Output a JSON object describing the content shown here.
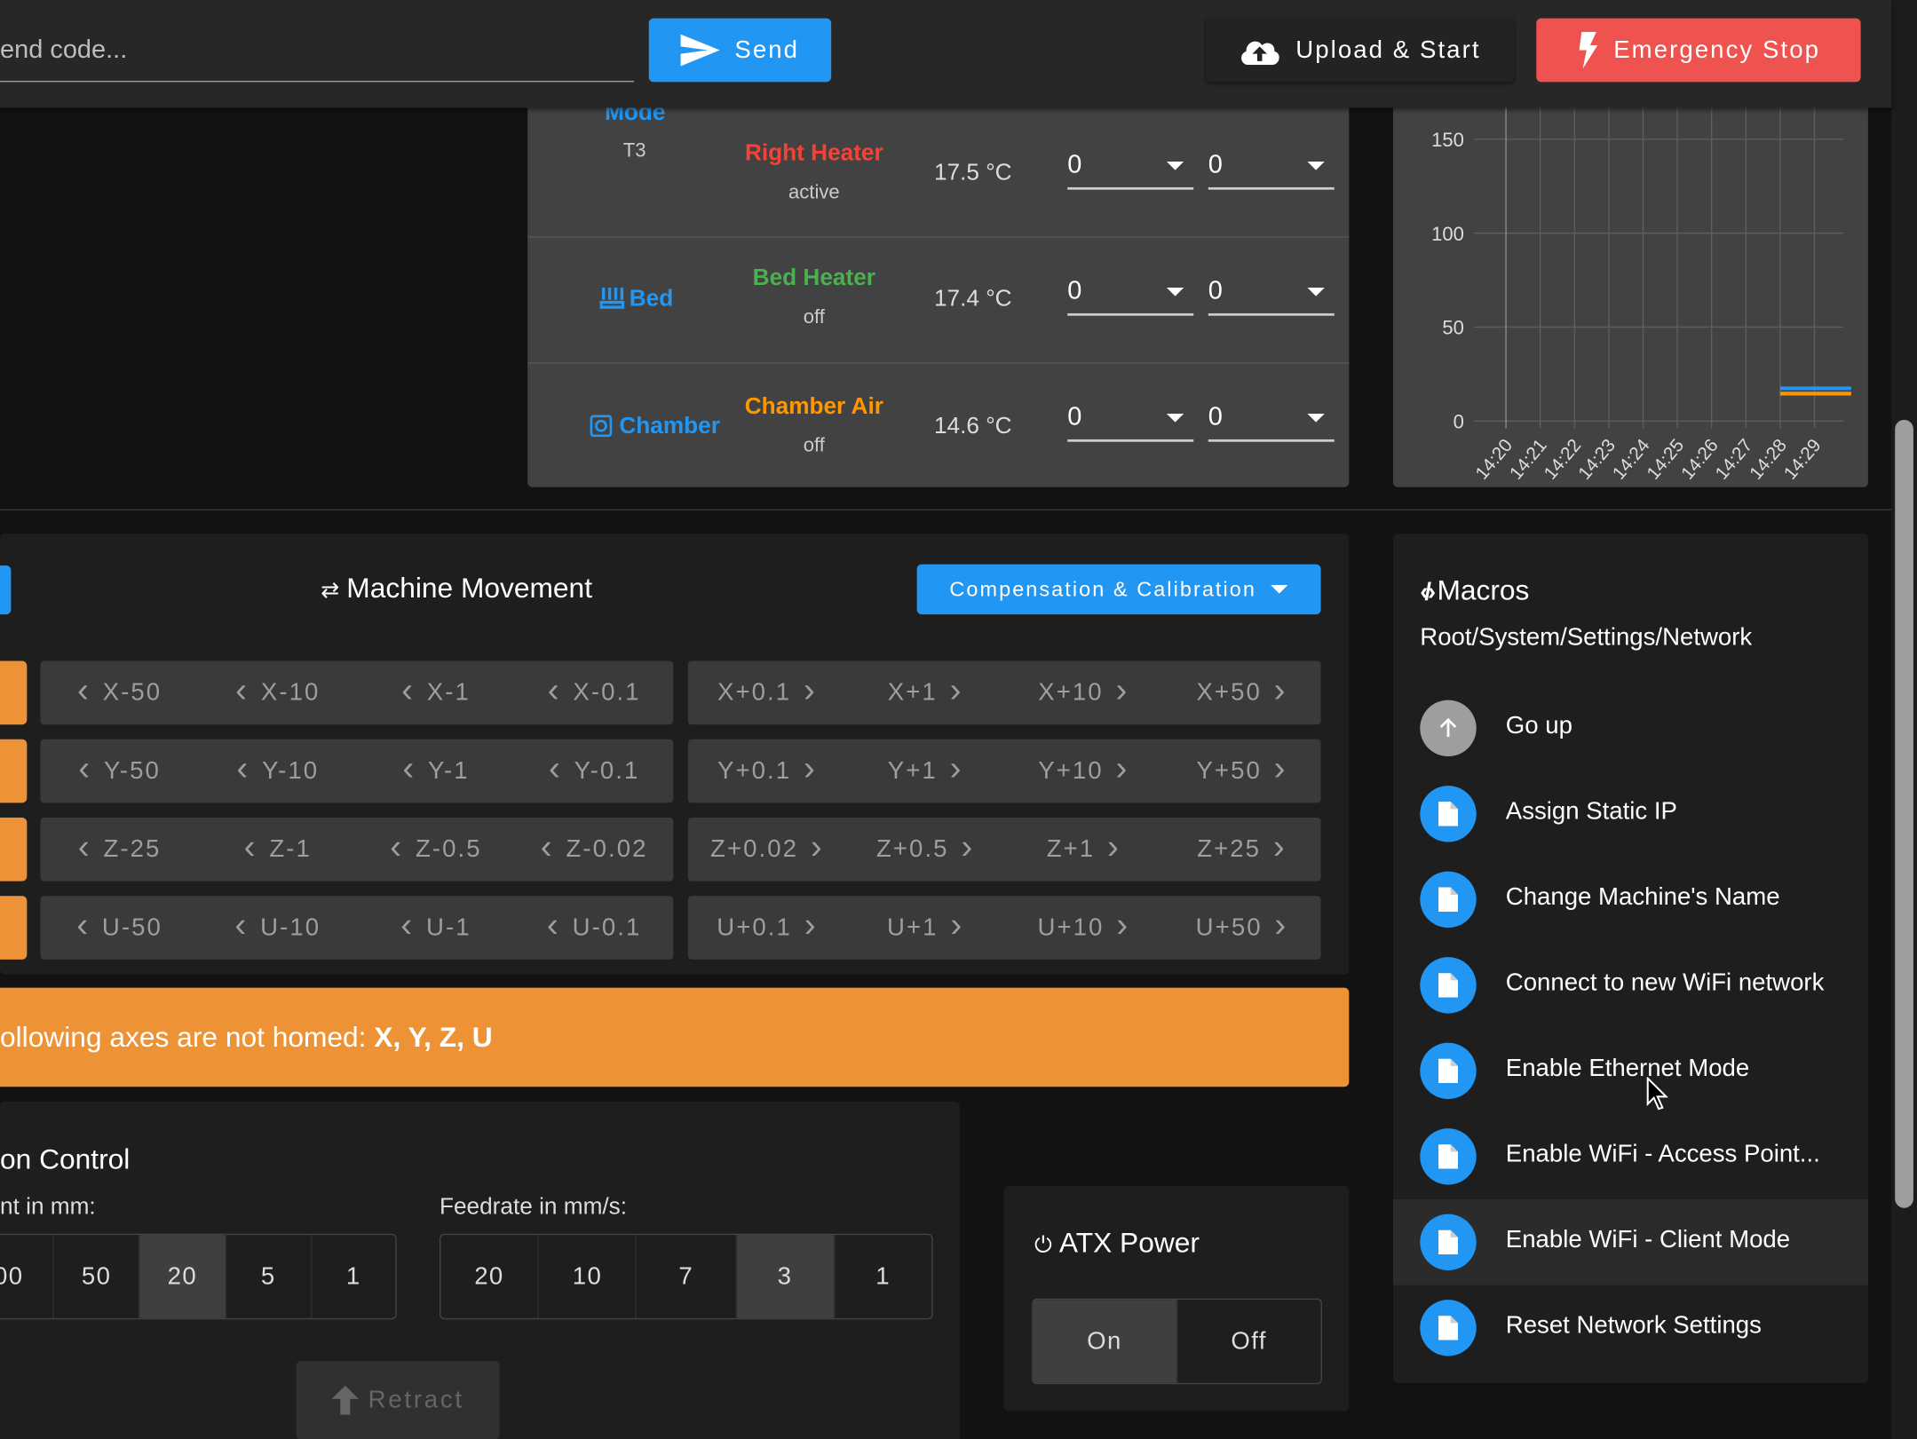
{
  "topbar": {
    "code_placeholder": "end code...",
    "send": "Send",
    "upload": "Upload & Start",
    "estop": "Emergency Stop"
  },
  "tools": {
    "partial_label": "Mode",
    "partial_sub": "T3",
    "rows": [
      {
        "tool": "",
        "heater": "Right Heater",
        "state": "active",
        "current": "17.5 °C",
        "active": "0",
        "standby": "0",
        "color": "#f44336"
      },
      {
        "tool": "Bed",
        "heater": "Bed Heater",
        "state": "off",
        "current": "17.4 °C",
        "active": "0",
        "standby": "0",
        "color": "#4caf50"
      },
      {
        "tool": "Chamber",
        "heater": "Chamber Air",
        "state": "off",
        "current": "14.6 °C",
        "active": "0",
        "standby": "0",
        "color": "#ff9800"
      }
    ]
  },
  "chart_data": {
    "type": "line",
    "title": "",
    "xlabel": "",
    "ylabel": "",
    "x": [
      "14:20",
      "14:21",
      "14:22",
      "14:23",
      "14:24",
      "14:25",
      "14:26",
      "14:27",
      "14:28",
      "14:29"
    ],
    "yticks": [
      0,
      50,
      100,
      150
    ],
    "ylim": [
      0,
      185
    ],
    "grid": true,
    "series": [
      {
        "color": "#2196f3",
        "values": [
          null,
          null,
          null,
          null,
          null,
          null,
          null,
          null,
          17.4,
          17.4
        ]
      },
      {
        "color": "#ff9800",
        "values": [
          null,
          null,
          null,
          null,
          null,
          null,
          null,
          null,
          14.6,
          14.6
        ]
      }
    ]
  },
  "movement": {
    "title": "Machine Movement",
    "compensation": "Compensation & Calibration",
    "rows": [
      {
        "minus": [
          "X-50",
          "X-10",
          "X-1",
          "X-0.1"
        ],
        "plus": [
          "X+0.1",
          "X+1",
          "X+10",
          "X+50"
        ]
      },
      {
        "minus": [
          "Y-50",
          "Y-10",
          "Y-1",
          "Y-0.1"
        ],
        "plus": [
          "Y+0.1",
          "Y+1",
          "Y+10",
          "Y+50"
        ]
      },
      {
        "minus": [
          "Z-25",
          "Z-1",
          "Z-0.5",
          "Z-0.02"
        ],
        "plus": [
          "Z+0.02",
          "Z+0.5",
          "Z+1",
          "Z+25"
        ]
      },
      {
        "minus": [
          "U-50",
          "U-10",
          "U-1",
          "U-0.1"
        ],
        "plus": [
          "U+0.1",
          "U+1",
          "U+10",
          "U+50"
        ]
      }
    ]
  },
  "warning": {
    "text": "ollowing axes are not homed: ",
    "axes": "X, Y, Z, U"
  },
  "extrusion": {
    "title": "on Control",
    "amount_label": "nt in mm:",
    "feedrate_label": "Feedrate in mm/s:",
    "amounts": [
      "00",
      "50",
      "20",
      "5",
      "1"
    ],
    "amount_selected": "20",
    "feedrates": [
      "20",
      "10",
      "7",
      "3",
      "1"
    ],
    "feedrate_selected": "3",
    "retract": "Retract"
  },
  "atx": {
    "title": "ATX Power",
    "on": "On",
    "off": "Off"
  },
  "macros": {
    "title": "Macros",
    "path": "Root/System/Settings/Network",
    "items": [
      "Go up",
      "Assign Static IP",
      "Change Machine's Name",
      "Connect to new WiFi network",
      "Enable Ethernet Mode",
      "Enable WiFi - Access Point...",
      "Enable WiFi - Client Mode",
      "Reset Network Settings"
    ]
  }
}
